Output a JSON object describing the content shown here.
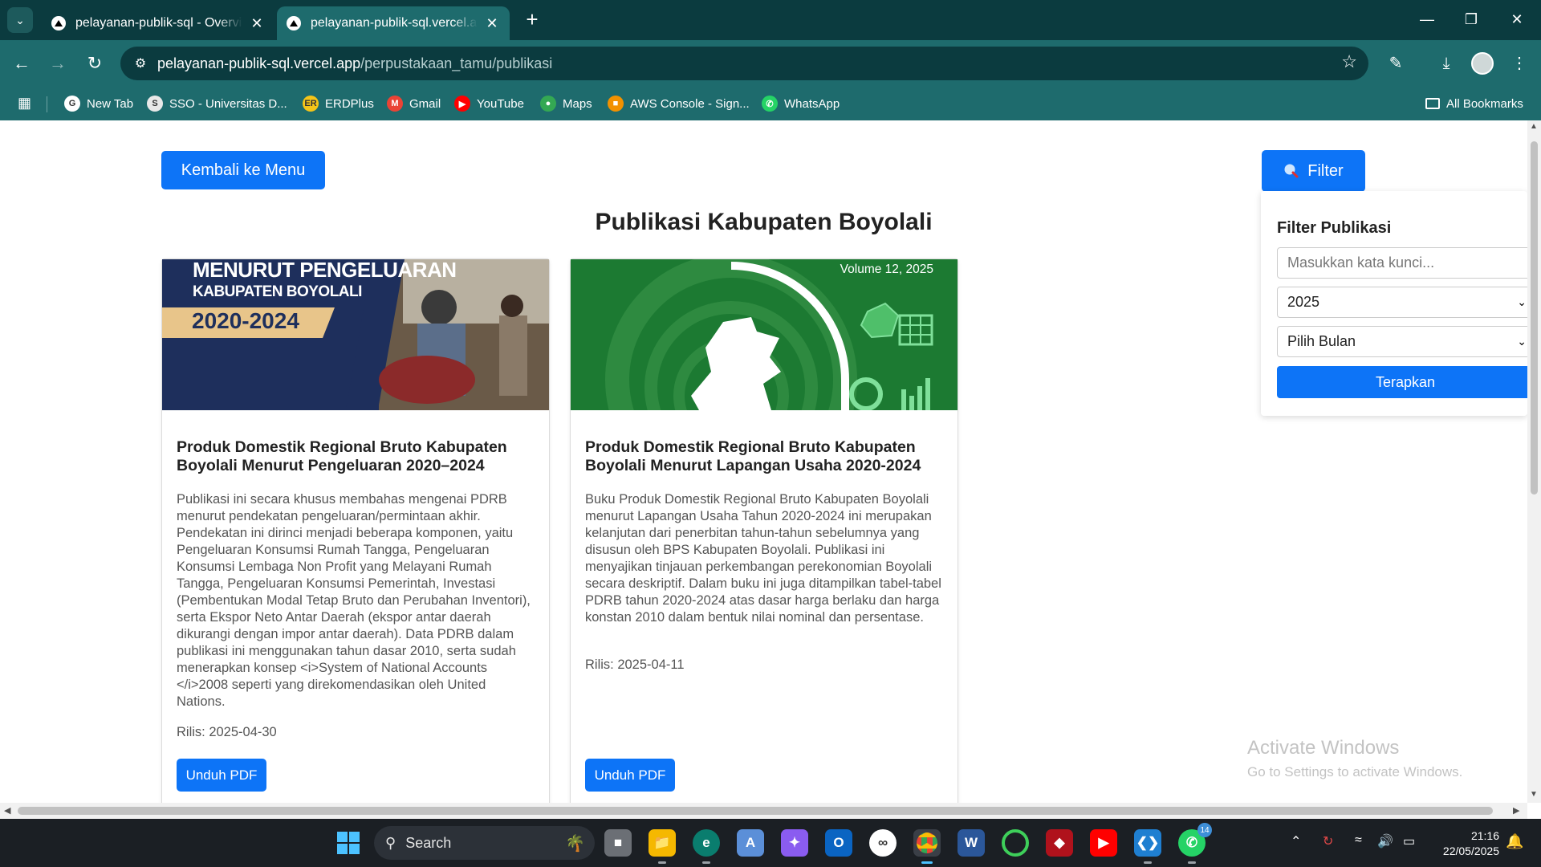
{
  "browser": {
    "tabs": [
      {
        "title": "pelayanan-publik-sql - Overview",
        "active": false
      },
      {
        "title": "pelayanan-publik-sql.vercel.app",
        "active": true
      }
    ],
    "new_tab_icon": "plus-icon",
    "url_host": "pelayanan-publik-sql.vercel.app",
    "url_path": "/perpustakaan_tamu/publikasi",
    "bookmarks": [
      {
        "label": "New Tab",
        "icon": "google-icon",
        "color": "#ffffff"
      },
      {
        "label": "SSO - Universitas D...",
        "icon": "sso-icon",
        "color": "#e8e8e8"
      },
      {
        "label": "ERDPlus",
        "icon": "erdplus-icon",
        "color": "#f5c518"
      },
      {
        "label": "Gmail",
        "icon": "gmail-icon",
        "color": "#ea4335"
      },
      {
        "label": "YouTube",
        "icon": "youtube-icon",
        "color": "#ff0000"
      },
      {
        "label": "Maps",
        "icon": "maps-icon",
        "color": "#34a853"
      },
      {
        "label": "AWS Console - Sign...",
        "icon": "aws-icon",
        "color": "#f29100"
      },
      {
        "label": "WhatsApp",
        "icon": "whatsapp-icon",
        "color": "#25d366"
      }
    ],
    "all_bookmarks_label": "All Bookmarks"
  },
  "page": {
    "back_button_label": "Kembali ke Menu",
    "filter_button_label": "Filter",
    "title": "Publikasi Kabupaten Boyolali",
    "publications": [
      {
        "cover_heading": "MENURUT PENGELUARAN",
        "cover_sub": "KABUPATEN BOYOLALI",
        "cover_years": "2020-2024",
        "title": "Produk Domestik Regional Bruto Kabupaten Boyolali Menurut Pengeluaran 2020–2024",
        "description": "Publikasi ini secara khusus membahas mengenai PDRB menurut pendekatan pengeluaran/permintaan akhir. Pendekatan ini dirinci menjadi beberapa komponen, yaitu Pengeluaran Konsumsi Rumah Tangga, Pengeluaran Konsumsi Lembaga Non Profit yang Melayani Rumah Tangga, Pengeluaran Konsumsi Pemerintah, Investasi (Pembentukan Modal Tetap Bruto dan Perubahan Inventori), serta Ekspor Neto Antar Daerah (ekspor antar daerah dikurangi dengan impor antar daerah). Data PDRB dalam publikasi ini menggunakan tahun dasar 2010, serta sudah menerapkan konsep <i>System of National Accounts </i>2008 seperti yang direkomendasikan oleh United Nations.",
        "release": "Rilis: 2025-04-30",
        "download_label": "Unduh PDF"
      },
      {
        "cover_volume": "Volume 12, 2025",
        "title": "Produk Domestik Regional Bruto Kabupaten Boyolali Menurut Lapangan Usaha 2020-2024",
        "description": "Buku Produk Domestik Regional Bruto Kabupaten Boyolali menurut Lapangan Usaha Tahun 2020-2024 ini merupakan kelanjutan dari penerbitan tahun-tahun sebelumnya yang disusun oleh BPS Kabupaten Boyolali. Publikasi ini menyajikan tinjauan perkembangan perekonomian Boyolali secara deskriptif. Dalam buku ini juga ditampilkan tabel-tabel PDRB tahun 2020-2024 atas dasar harga berlaku dan harga konstan 2010 dalam bentuk nilai nominal dan persentase.",
        "release": "Rilis: 2025-04-11",
        "download_label": "Unduh PDF"
      }
    ],
    "filter_panel": {
      "title": "Filter Publikasi",
      "keyword_placeholder": "Masukkan kata kunci...",
      "year_value": "2025",
      "month_value": "Pilih Bulan",
      "apply_label": "Terapkan"
    },
    "watermark": {
      "line1": "Activate Windows",
      "line2": "Go to Settings to activate Windows."
    }
  },
  "taskbar": {
    "search_label": "Search",
    "whatsapp_badge": "14",
    "time": "21:16",
    "date": "22/05/2025"
  },
  "colors": {
    "primary_button": "#0d74f7",
    "chrome_dark": "#0b3b3f",
    "chrome_toolbar": "#1e6b6d"
  }
}
